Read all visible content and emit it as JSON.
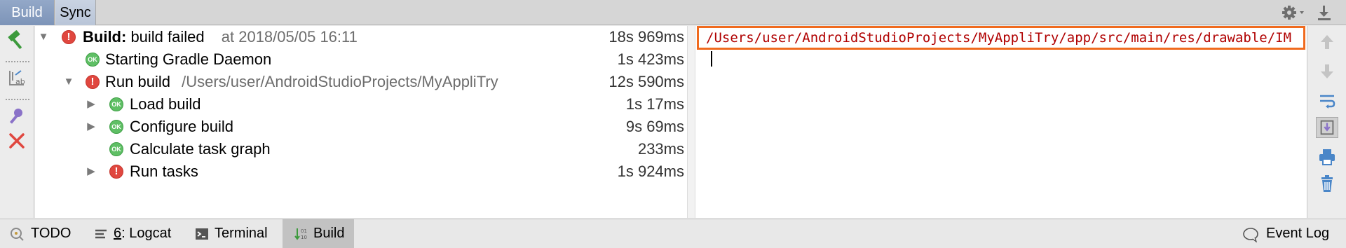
{
  "top_tabs": [
    {
      "label": "Build",
      "active": true
    },
    {
      "label": "Sync",
      "active": false
    }
  ],
  "tree": [
    {
      "id": "build",
      "expanded": true,
      "status": "error",
      "title_bold": "Build:",
      "title": " build failed",
      "detail": "at 2018/05/05 16:11",
      "duration": "18s 969ms"
    },
    {
      "id": "daemon",
      "status": "ok",
      "title": "Starting Gradle Daemon",
      "duration": "1s 423ms"
    },
    {
      "id": "runbuild",
      "expanded": true,
      "status": "error",
      "title": "Run build",
      "detail": "/Users/user/AndroidStudioProjects/MyAppliTry",
      "duration": "12s 590ms"
    },
    {
      "id": "load",
      "expanded": false,
      "status": "ok",
      "title": "Load build",
      "duration": "1s 17ms"
    },
    {
      "id": "configure",
      "expanded": false,
      "status": "ok",
      "title": "Configure build",
      "duration": "9s 69ms"
    },
    {
      "id": "taskgraph",
      "status": "ok",
      "title": "Calculate task graph",
      "duration": "233ms"
    },
    {
      "id": "runtasks",
      "expanded": false,
      "status": "error",
      "title": "Run tasks",
      "duration": "1s 924ms"
    }
  ],
  "status_ok_text": "OK",
  "status_err_text": "!",
  "console": {
    "error_line": "/Users/user/AndroidStudioProjects/MyAppliTry/app/src/main/res/drawable/IM"
  },
  "bottom_tabs": [
    {
      "label": "TODO",
      "icon": "todo-icon"
    },
    {
      "mnemonic": "6",
      "label": ": Logcat",
      "icon": "logcat-icon"
    },
    {
      "label": "Terminal",
      "icon": "terminal-icon"
    },
    {
      "label": "Build",
      "icon": "build-icon",
      "active": true
    },
    {
      "label": "Event Log",
      "icon": "event-log-icon"
    }
  ],
  "colors": {
    "error_red": "#e0473f",
    "ok_green": "#5fbf65",
    "highlight_border": "#f06a1e",
    "console_text": "#b00000"
  }
}
